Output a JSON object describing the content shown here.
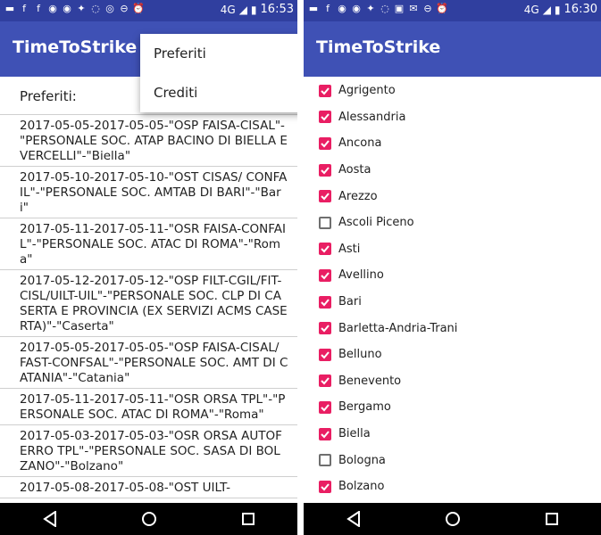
{
  "left": {
    "status": {
      "network": "4G",
      "time": "16:53"
    },
    "app_title": "TimeToStrike",
    "menu": [
      {
        "label": "Preferiti"
      },
      {
        "label": "Crediti"
      }
    ],
    "list_label": "Preferiti:",
    "items": [
      "2017-05-05-2017-05-05-\"OSP FAISA-CISAL\"-\"PERSONALE SOC. ATAP BACINO DI BIELLA E VERCELLI\"-\"Biella\"",
      "2017-05-10-2017-05-10-\"OST CISAS/ CONFAIL\"-\"PERSONALE SOC. AMTAB DI BARI\"-\"Bari\"",
      "2017-05-11-2017-05-11-\"OSR FAISA-CONFAIL\"-\"PERSONALE SOC. ATAC DI ROMA\"-\"Roma\"",
      "2017-05-12-2017-05-12-\"OSP FILT-CGIL/FIT-CISL/UILT-UIL\"-\"PERSONALE SOC. CLP DI CASERTA E PROVINCIA (EX SERVIZI ACMS CASERTA)\"-\"Caserta\"",
      "2017-05-05-2017-05-05-\"OSP FAISA-CISAL/ FAST-CONFSAL\"-\"PERSONALE SOC. AMT DI CATANIA\"-\"Catania\"",
      "2017-05-11-2017-05-11-\"OSR ORSA TPL\"-\"PERSONALE SOC. ATAC DI ROMA\"-\"Roma\"",
      "2017-05-03-2017-05-03-\"OSR ORSA AUTOFERRO TPL\"-\"PERSONALE SOC. SASA DI BOLZANO\"-\"Bolzano\"",
      "2017-05-08-2017-05-08-\"OST UILT-"
    ]
  },
  "right": {
    "status": {
      "network": "4G",
      "time": "16:30"
    },
    "app_title": "TimeToStrike",
    "cities": [
      {
        "name": "Agrigento",
        "checked": true
      },
      {
        "name": "Alessandria",
        "checked": true
      },
      {
        "name": "Ancona",
        "checked": true
      },
      {
        "name": "Aosta",
        "checked": true
      },
      {
        "name": "Arezzo",
        "checked": true
      },
      {
        "name": "Ascoli Piceno",
        "checked": false
      },
      {
        "name": "Asti",
        "checked": true
      },
      {
        "name": "Avellino",
        "checked": true
      },
      {
        "name": "Bari",
        "checked": true
      },
      {
        "name": "Barletta-Andria-Trani",
        "checked": true
      },
      {
        "name": "Belluno",
        "checked": true
      },
      {
        "name": "Benevento",
        "checked": true
      },
      {
        "name": "Bergamo",
        "checked": true
      },
      {
        "name": "Biella",
        "checked": true
      },
      {
        "name": "Bologna",
        "checked": false
      },
      {
        "name": "Bolzano",
        "checked": true
      }
    ]
  },
  "colors": {
    "accent": "#e91e63",
    "appbar": "#3F51B5",
    "statusbar": "#303F9F"
  },
  "icons": {
    "status_left": [
      "message-icon",
      "facebook-icon",
      "facebook-icon",
      "messenger-icon",
      "messenger-icon",
      "twitter-icon",
      "whatsapp-icon",
      "instagram-icon",
      "minus-circle-icon",
      "alarm-icon"
    ],
    "nav": [
      "back-icon",
      "home-icon",
      "recents-icon"
    ]
  }
}
